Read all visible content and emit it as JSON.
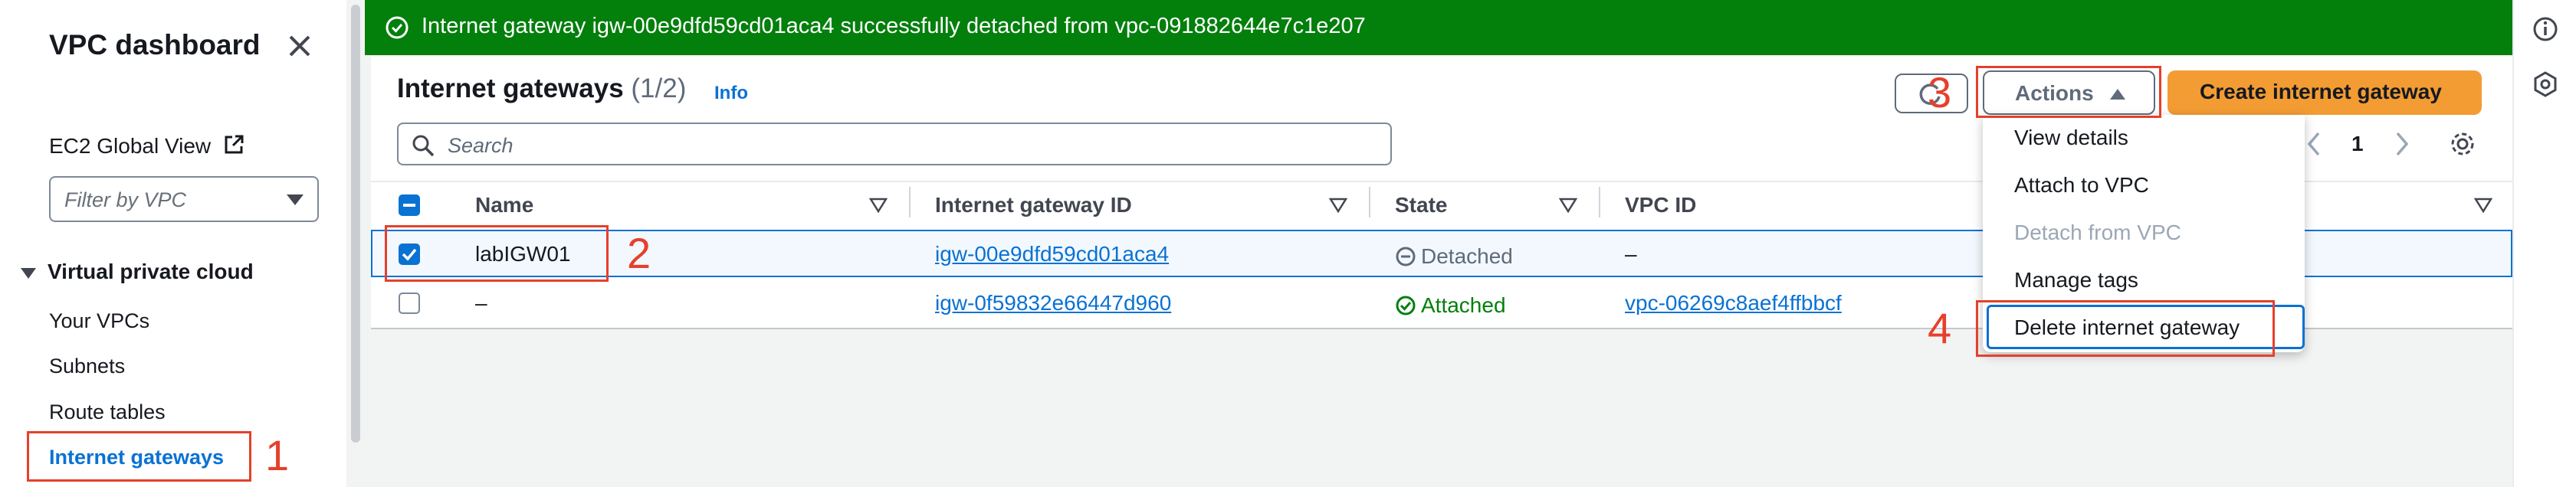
{
  "flash": {
    "message": "Internet gateway igw-00e9dfd59cd01aca4 successfully detached from vpc-091882644e7c1e207",
    "color": "#037f0c"
  },
  "sidebar": {
    "title": "VPC dashboard",
    "ec2_global_view": "EC2 Global View",
    "filter_placeholder": "Filter by VPC",
    "section_label": "Virtual private cloud",
    "items": [
      {
        "label": "Your VPCs"
      },
      {
        "label": "Subnets"
      },
      {
        "label": "Route tables"
      },
      {
        "label": "Internet gateways",
        "active": true
      }
    ]
  },
  "panel": {
    "title": "Internet gateways",
    "count": "(1/2)",
    "info": "Info",
    "search_placeholder": "Search",
    "page_number": "1"
  },
  "toolbar": {
    "actions_label": "Actions",
    "create_label": "Create internet gateway"
  },
  "table": {
    "columns": [
      "Name",
      "Internet gateway ID",
      "State",
      "VPC ID"
    ],
    "rows": [
      {
        "selected": true,
        "name": "labIGW01",
        "id": "igw-00e9dfd59cd01aca4",
        "state": "Detached",
        "vpc": "–"
      },
      {
        "selected": false,
        "name": "–",
        "id": "igw-0f59832e66447d960",
        "state": "Attached",
        "vpc": "vpc-06269c8aef4ffbbcf"
      }
    ]
  },
  "actions_menu": {
    "items": [
      {
        "label": "View details",
        "disabled": false
      },
      {
        "label": "Attach to VPC",
        "disabled": false
      },
      {
        "label": "Detach from VPC",
        "disabled": true
      },
      {
        "label": "Manage tags",
        "disabled": false
      },
      {
        "label": "Delete internet gateway",
        "disabled": false
      }
    ]
  },
  "annotations": [
    "1",
    "2",
    "3",
    "4"
  ],
  "colors": {
    "accent": "#0972d3",
    "primary_button": "#f39c33",
    "success": "#037f0c",
    "annotation": "#e6402b"
  },
  "icons": [
    "close-icon",
    "external-link-icon",
    "caret-down-icon",
    "search-icon",
    "refresh-icon",
    "caret-up-icon",
    "chevron-left-icon",
    "chevron-right-icon",
    "settings-icon",
    "sort-icon",
    "success-icon",
    "detached-icon",
    "info-icon"
  ]
}
